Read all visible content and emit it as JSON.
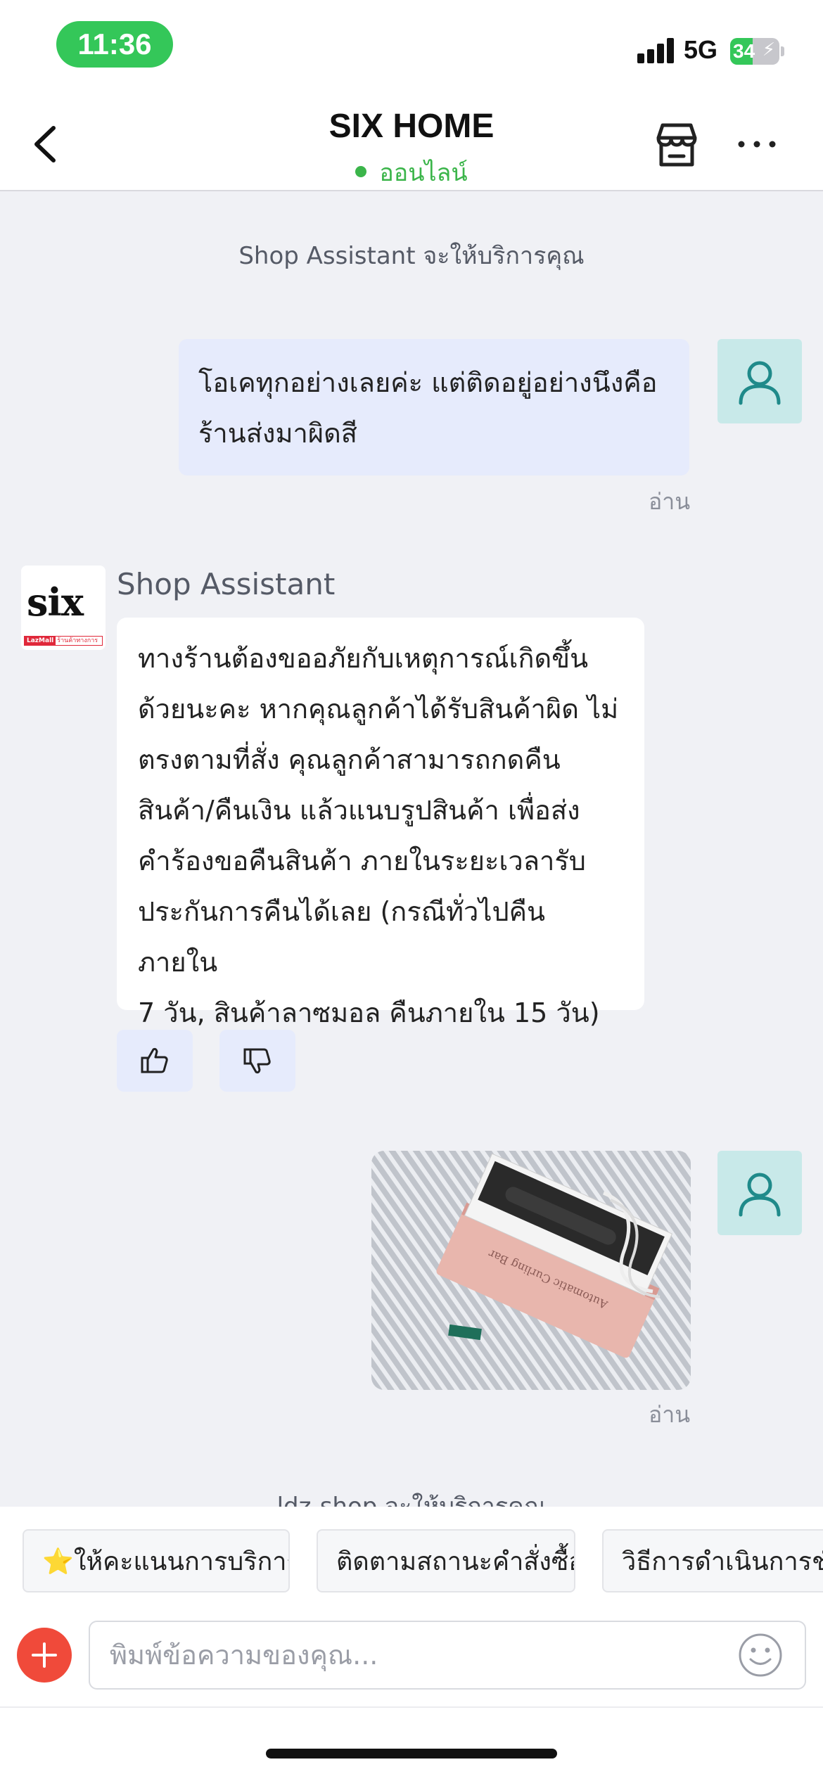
{
  "status_bar": {
    "time": "11:36",
    "network": "5G",
    "battery": "34",
    "battery_level_percent": 34
  },
  "header": {
    "title": "SIX HOME",
    "status": "ออนไลน์",
    "status_color": "#3bb54a"
  },
  "chat": {
    "system_note_1": "Shop Assistant จะให้บริการคุณ",
    "user_message_1_line1": "โอเคทุกอย่างเลยค่ะ แต่ติดอยู่อย่างนึงคือ",
    "user_message_1_line2": "ร้านส่งมาผิดสี",
    "read_label": "อ่าน",
    "bot_sender": "Shop Assistant",
    "bot_logo_text": "six",
    "bot_logo_badge_1": "LazMall",
    "bot_logo_badge_2": "ร้านค้าทางการ",
    "bot_message_lines": [
      "ทางร้านต้องขออภัยกับเหตุการณ์เกิดขึ้น",
      "ด้วยนะคะ หากคุณลูกค้าได้รับสินค้าผิด ไม่",
      "ตรงตามที่สั่ง คุณลูกค้าสามารถกดคืน",
      "สินค้า/คืนเงิน แล้วแนบรูปสินค้า เพื่อส่ง",
      "คำร้องขอคืนสินค้า ภายในระยะเวลารับ",
      "ประกันการคืนได้เลย (กรณีทั่วไปคืนภายใน",
      "7 วัน, สินค้าลาซมอล คืนภายใน 15 วัน)"
    ],
    "photo_box_text": "Automatic Curling Bar",
    "read_label_2": "อ่าน",
    "system_note_2": "ldz-shop จะให้บริการคุณ"
  },
  "quick_replies": [
    "⭐ให้คะแนนการบริการ",
    "ติดตามสถานะคำสั่งซื้อ",
    "วิธีการดำเนินการชำระ"
  ],
  "composer": {
    "placeholder": "พิมพ์ข้อความของคุณ..."
  },
  "icons": {
    "back": "chevron-left-icon",
    "store": "store-icon",
    "more": "more-dots-icon",
    "user_avatar": "user-icon",
    "thumbs_up": "thumbs-up-icon",
    "thumbs_down": "thumbs-down-icon",
    "add": "plus-icon",
    "emoji": "smiley-icon"
  },
  "colors": {
    "accent_green": "#34c759",
    "user_bubble": "#e6ebfc",
    "avatar_bg": "#c8e9e9",
    "add_button": "#f04a3a"
  }
}
